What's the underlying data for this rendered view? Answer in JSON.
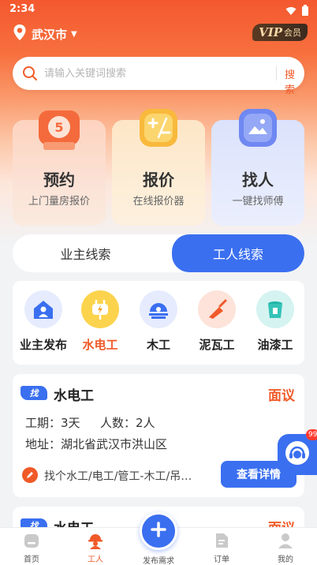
{
  "status_bar": {
    "time": "2:34"
  },
  "location": {
    "city": "武汉市"
  },
  "vip": {
    "main": "VIP",
    "sub": "会员"
  },
  "search": {
    "placeholder": "请输入关键词搜索",
    "button": "搜索"
  },
  "services": [
    {
      "title": "预约",
      "subtitle": "上门量房报价",
      "icon": "tape-measure-icon",
      "icon_text": "5"
    },
    {
      "title": "报价",
      "subtitle": "在线报价器",
      "icon": "calculator-icon"
    },
    {
      "title": "找人",
      "subtitle": "一键找师傅",
      "icon": "find-person-icon"
    }
  ],
  "tabs": [
    {
      "label": "业主线索",
      "active": false
    },
    {
      "label": "工人线索",
      "active": true
    }
  ],
  "categories": [
    {
      "label": "业主发布",
      "icon": "house-person-icon",
      "active": false
    },
    {
      "label": "水电工",
      "icon": "plug-icon",
      "active": true
    },
    {
      "label": "木工",
      "icon": "saw-icon",
      "active": false
    },
    {
      "label": "泥瓦工",
      "icon": "trowel-icon",
      "active": false
    },
    {
      "label": "油漆工",
      "icon": "paint-bucket-icon",
      "active": false
    }
  ],
  "job": {
    "tag": "找",
    "title": "水电工",
    "price": "面议",
    "duration": "工期：3天",
    "people": "人数：2人",
    "address": "地址：湖北省武汉市洪山区",
    "description": "找个水工/电工/管工-木工/吊…",
    "detail_button": "查看详情"
  },
  "job2": {
    "tag": "找",
    "title": "水电工",
    "price": "面议"
  },
  "float_chat": {
    "badge": "99"
  },
  "bottom_nav": [
    {
      "label": "首页",
      "icon": "home-icon",
      "active": false
    },
    {
      "label": "工人",
      "icon": "worker-icon",
      "active": true
    },
    {
      "label": "发布需求",
      "icon": "plus-icon",
      "active": false
    },
    {
      "label": "订单",
      "icon": "order-icon",
      "active": false
    },
    {
      "label": "我的",
      "icon": "profile-icon",
      "active": false
    }
  ],
  "colors": {
    "accent": "#f05a28",
    "primary_blue": "#3a6ff0"
  }
}
